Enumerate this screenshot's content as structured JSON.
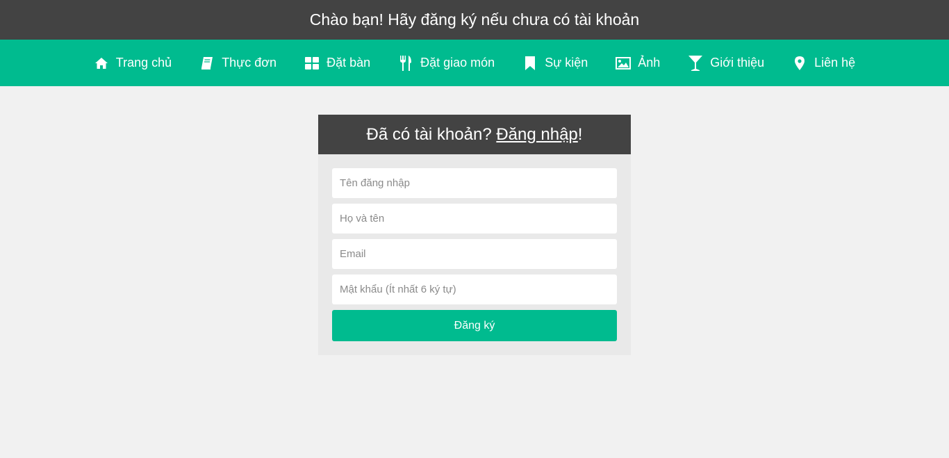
{
  "header": {
    "greeting": "Chào bạn! Hãy đăng ký nếu chưa có tài khoản"
  },
  "nav": {
    "items": [
      {
        "label": "Trang chủ",
        "icon": "home-icon"
      },
      {
        "label": "Thực đơn",
        "icon": "book-icon"
      },
      {
        "label": "Đặt bàn",
        "icon": "grid-icon"
      },
      {
        "label": "Đặt giao món",
        "icon": "cutlery-icon"
      },
      {
        "label": "Sự kiện",
        "icon": "bookmark-icon"
      },
      {
        "label": "Ảnh",
        "icon": "image-icon"
      },
      {
        "label": "Giới thiệu",
        "icon": "cocktail-icon"
      },
      {
        "label": "Liên hệ",
        "icon": "map-marker-icon"
      }
    ]
  },
  "panel": {
    "prefix": "Đã có tài khoản? ",
    "login_link": "Đăng nhập",
    "suffix": "!"
  },
  "form": {
    "username_placeholder": "Tên đăng nhập",
    "fullname_placeholder": "Họ và tên",
    "email_placeholder": "Email",
    "password_placeholder": "Mật khẩu (Ít nhất 6 ký tự)",
    "submit_label": "Đăng ký"
  },
  "colors": {
    "dark": "#434343",
    "accent": "#00bb8f",
    "background": "#f1f1f1",
    "panel": "#e9e9e9"
  }
}
